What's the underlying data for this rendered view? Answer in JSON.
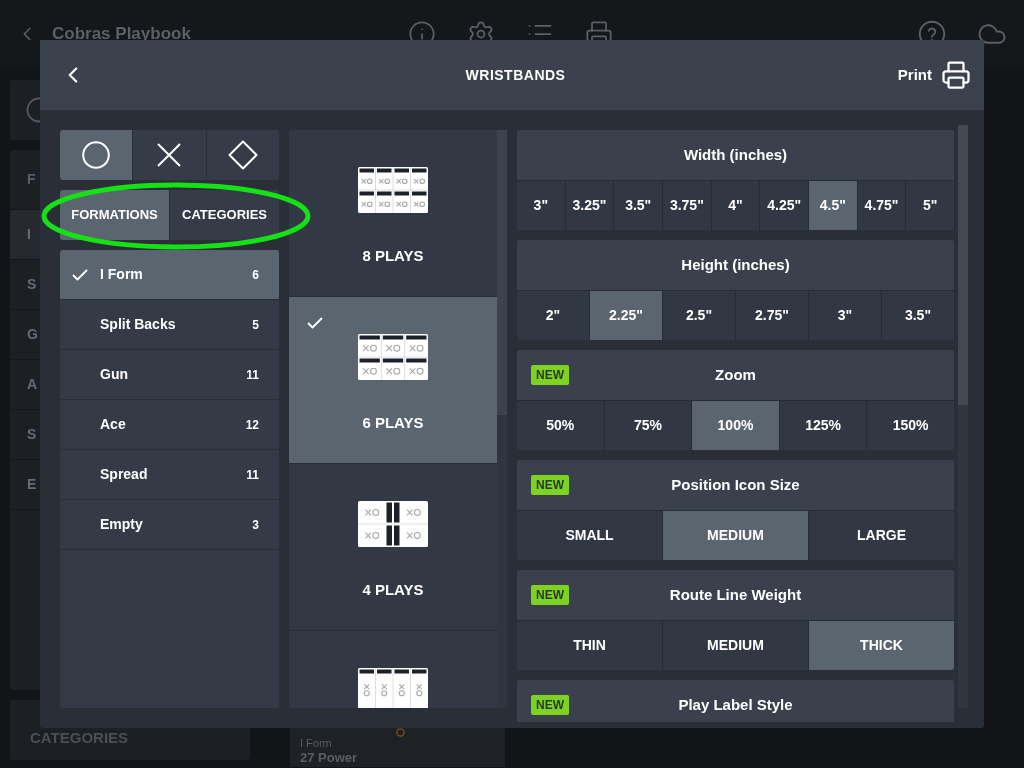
{
  "background": {
    "header": {
      "title": "Cobras Playbook"
    },
    "sidebar": {
      "header": "F",
      "items": [
        {
          "label": "I",
          "selected": true
        },
        {
          "label": "S",
          "selected": false
        },
        {
          "label": "G",
          "selected": false
        },
        {
          "label": "A",
          "selected": false
        },
        {
          "label": "S",
          "selected": false
        },
        {
          "label": "E",
          "selected": false
        }
      ],
      "footer": "CATEGORIES"
    },
    "play_card": {
      "formation": "I Form",
      "title": "27 Power"
    }
  },
  "modal": {
    "title": "WRISTBANDS",
    "print": "Print"
  },
  "shape_toggle": [
    {
      "kind": "circle",
      "selected": true
    },
    {
      "kind": "cross",
      "selected": false
    },
    {
      "kind": "diamond",
      "selected": false
    }
  ],
  "tabs": [
    {
      "label": "FORMATIONS",
      "selected": true
    },
    {
      "label": "CATEGORIES",
      "selected": false
    }
  ],
  "formations": [
    {
      "name": "I Form",
      "count": "6",
      "selected": true
    },
    {
      "name": "Split Backs",
      "count": "5",
      "selected": false
    },
    {
      "name": "Gun",
      "count": "11",
      "selected": false
    },
    {
      "name": "Ace",
      "count": "12",
      "selected": false
    },
    {
      "name": "Spread",
      "count": "11",
      "selected": false
    },
    {
      "name": "Empty",
      "count": "3",
      "selected": false
    }
  ],
  "layouts": [
    {
      "kind": "grid8",
      "label": "8 PLAYS",
      "selected": false
    },
    {
      "kind": "grid6",
      "label": "6 PLAYS",
      "selected": true
    },
    {
      "kind": "grid4",
      "label": "4 PLAYS",
      "selected": false
    },
    {
      "kind": "columns4",
      "selected": false
    }
  ],
  "settings": [
    {
      "title": "Width (inches)",
      "options": [
        {
          "label": "3\"",
          "selected": false
        },
        {
          "label": "3.25\"",
          "selected": false
        },
        {
          "label": "3.5\"",
          "selected": false
        },
        {
          "label": "3.75\"",
          "selected": false
        },
        {
          "label": "4\"",
          "selected": false
        },
        {
          "label": "4.25\"",
          "selected": false
        },
        {
          "label": "4.5\"",
          "selected": true
        },
        {
          "label": "4.75\"",
          "selected": false
        },
        {
          "label": "5\"",
          "selected": false
        }
      ]
    },
    {
      "title": "Height (inches)",
      "options": [
        {
          "label": "2\"",
          "selected": false
        },
        {
          "label": "2.25\"",
          "selected": true
        },
        {
          "label": "2.5\"",
          "selected": false
        },
        {
          "label": "2.75\"",
          "selected": false
        },
        {
          "label": "3\"",
          "selected": false
        },
        {
          "label": "3.5\"",
          "selected": false
        }
      ]
    },
    {
      "badge": "NEW",
      "title": "Zoom",
      "options": [
        {
          "label": "50%",
          "selected": false
        },
        {
          "label": "75%",
          "selected": false
        },
        {
          "label": "100%",
          "selected": true
        },
        {
          "label": "125%",
          "selected": false
        },
        {
          "label": "150%",
          "selected": false
        }
      ]
    },
    {
      "badge": "NEW",
      "title": "Position Icon Size",
      "options": [
        {
          "label": "SMALL",
          "selected": false
        },
        {
          "label": "MEDIUM",
          "selected": true
        },
        {
          "label": "LARGE",
          "selected": false
        }
      ]
    },
    {
      "badge": "NEW",
      "title": "Route Line Weight",
      "options": [
        {
          "label": "THIN",
          "selected": false
        },
        {
          "label": "MEDIUM",
          "selected": false
        },
        {
          "label": "THICK",
          "selected": true
        }
      ]
    },
    {
      "badge": "NEW",
      "title": "Play Label Style"
    }
  ]
}
